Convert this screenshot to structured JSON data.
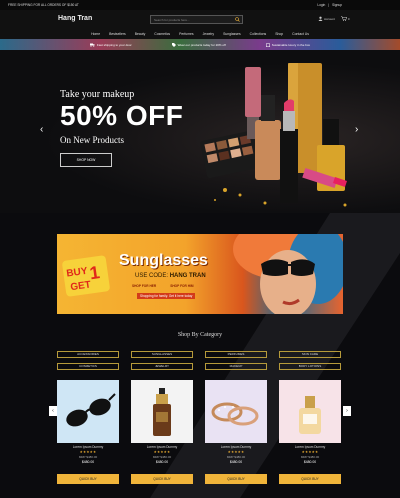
{
  "topbar": {
    "shipping": "FREE SHIPPING FOR ALL ORDERS OF $150 AT",
    "login": "Login",
    "signup": "Signup",
    "sep": "|"
  },
  "header": {
    "logo": "Hang Tran",
    "search_placeholder": "Search for products here...",
    "account_label": "Account",
    "cart_label": "0"
  },
  "nav": {
    "items": [
      "Home",
      "Bestsellers",
      "Beauty",
      "Cosmetics",
      "Perfumes",
      "Jewelry",
      "Sunglasses",
      "Collections",
      "Shop",
      "Contact Us"
    ]
  },
  "promo": {
    "items": [
      "Fast shipping to your door",
      "Wear our products today for 20% off",
      "Sustainable luxury in the box"
    ]
  },
  "hero": {
    "subtitle": "Take your makeup",
    "headline": "50% OFF",
    "line3": "On New Products",
    "button": "SHOP NOW"
  },
  "banner": {
    "buy_text": "BUY",
    "buy_num": "1",
    "get_text": "GET",
    "title": "Sunglasses",
    "code_prefix": "USE CODE:",
    "code": "HANG TRAN",
    "link_her": "SHOP FOR HER",
    "link_him": "SHOP FOR HIM",
    "note": "Shopping for family. Get it here today"
  },
  "categories": {
    "title": "Shop By Category",
    "chips": [
      "ACCESSORIES",
      "SUNGLASSES",
      "PERFUMES",
      "SKIN CARE",
      "COSMETICS",
      "JEWELRY",
      "MAKEUP",
      "BODY LOTIONS"
    ]
  },
  "products": [
    {
      "name": "Lorem Ipsum Dummy",
      "stars": "★★★★★",
      "mrp": "MRP $480.00",
      "price": "$480.00",
      "button": "QUICK BUY"
    },
    {
      "name": "Lorem Ipsum Dummy",
      "stars": "★★★★★",
      "mrp": "MRP $480.00",
      "price": "$480.00",
      "button": "QUICK BUY"
    },
    {
      "name": "Lorem Ipsum Dummy",
      "stars": "★★★★★",
      "mrp": "MRP $480.00",
      "price": "$480.00",
      "button": "QUICK BUY"
    },
    {
      "name": "Lorem Ipsum Dummy",
      "stars": "★★★★★",
      "mrp": "MRP $480.00",
      "price": "$480.00",
      "button": "QUICK BUY"
    }
  ],
  "icons": {
    "search": "search-icon",
    "user": "user-icon",
    "cart": "cart-icon",
    "prev": "chevron-left-icon",
    "next": "chevron-right-icon"
  },
  "colors": {
    "accent": "#f0b43a",
    "background": "#0b0b0e"
  }
}
